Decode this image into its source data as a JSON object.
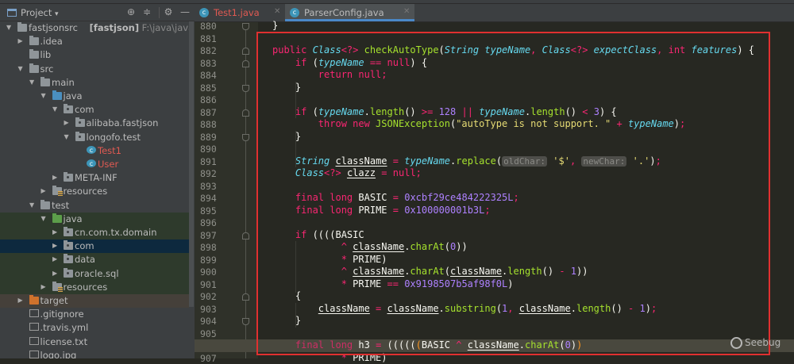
{
  "panel": {
    "title": "Project",
    "dropdown_icon": "▾",
    "icons": [
      "locate-icon",
      "collapse-all-icon",
      "gear-icon",
      "minimize-icon"
    ]
  },
  "tree": [
    {
      "label": "fastjsonsrc",
      "bold": "[fastjson]",
      "path": "F:\\java\\javaproject\\fast",
      "depth": 0,
      "arrow": "open",
      "icon": "module"
    },
    {
      "label": ".idea",
      "depth": 1,
      "arrow": "closed",
      "icon": "folder"
    },
    {
      "label": "lib",
      "depth": 1,
      "arrow": "none",
      "icon": "folder"
    },
    {
      "label": "src",
      "depth": 1,
      "arrow": "open",
      "icon": "folder"
    },
    {
      "label": "main",
      "depth": 2,
      "arrow": "open",
      "icon": "folder"
    },
    {
      "label": "java",
      "depth": 3,
      "arrow": "open",
      "icon": "src"
    },
    {
      "label": "com",
      "depth": 4,
      "arrow": "open",
      "icon": "package"
    },
    {
      "label": "alibaba.fastjson",
      "depth": 5,
      "arrow": "closed",
      "icon": "package"
    },
    {
      "label": "longofo.test",
      "depth": 5,
      "arrow": "open",
      "icon": "package"
    },
    {
      "label": "Test1",
      "depth": 6,
      "arrow": "none",
      "icon": "class",
      "color": "#e05a52"
    },
    {
      "label": "User",
      "depth": 6,
      "arrow": "none",
      "icon": "class",
      "color": "#e05a52"
    },
    {
      "label": "META-INF",
      "depth": 4,
      "arrow": "closed",
      "icon": "package"
    },
    {
      "label": "resources",
      "depth": 3,
      "arrow": "closed",
      "icon": "resources"
    },
    {
      "label": "test",
      "depth": 2,
      "arrow": "open",
      "icon": "folder"
    },
    {
      "label": "java",
      "depth": 3,
      "arrow": "open",
      "icon": "test",
      "bg": "#2e3a2c"
    },
    {
      "label": "cn.com.tx.domain",
      "depth": 4,
      "arrow": "closed",
      "icon": "package",
      "bg": "#2e3a2c"
    },
    {
      "label": "com",
      "depth": 4,
      "arrow": "closed",
      "icon": "package",
      "bg": "#0d293e"
    },
    {
      "label": "data",
      "depth": 4,
      "arrow": "closed",
      "icon": "package",
      "bg": "#2e3a2c"
    },
    {
      "label": "oracle.sql",
      "depth": 4,
      "arrow": "closed",
      "icon": "package",
      "bg": "#2e3a2c"
    },
    {
      "label": "resources",
      "depth": 3,
      "arrow": "closed",
      "icon": "resources",
      "bg": "#2e3a2c"
    },
    {
      "label": "target",
      "depth": 1,
      "arrow": "closed",
      "icon": "target",
      "bg": "#45403a"
    },
    {
      "label": ".gitignore",
      "depth": 1,
      "arrow": "none",
      "icon": "file"
    },
    {
      "label": ".travis.yml",
      "depth": 1,
      "arrow": "none",
      "icon": "file"
    },
    {
      "label": "license.txt",
      "depth": 1,
      "arrow": "none",
      "icon": "file"
    },
    {
      "label": "logo.jpg",
      "depth": 1,
      "arrow": "none",
      "icon": "file"
    }
  ],
  "tabs": [
    {
      "label": "Test1.java",
      "active": false,
      "color": "#e05a52"
    },
    {
      "label": "ParserConfig.java",
      "active": true,
      "color": "#bbbbbb"
    }
  ],
  "editor": {
    "current_line": 906,
    "lines": [
      {
        "no": 880,
        "fold": "end",
        "tokens": [
          [
            "x",
            "}"
          ]
        ]
      },
      {
        "no": 881,
        "tokens": []
      },
      {
        "no": 882,
        "fold": "start",
        "tokens": [
          [
            "k",
            "public "
          ],
          [
            "t",
            "Class"
          ],
          [
            "k",
            "<?>"
          ],
          [
            "x",
            " "
          ],
          [
            "f",
            "checkAutoType"
          ],
          [
            "x",
            "("
          ],
          [
            "t",
            "String"
          ],
          [
            "x",
            " "
          ],
          [
            "p",
            "typeName"
          ],
          [
            "o",
            ", "
          ],
          [
            "t",
            "Class"
          ],
          [
            "k",
            "<?>"
          ],
          [
            "x",
            " "
          ],
          [
            "p",
            "expectClass"
          ],
          [
            "o",
            ", "
          ],
          [
            "k",
            "int "
          ],
          [
            "p",
            "features"
          ],
          [
            "x",
            ") {"
          ]
        ]
      },
      {
        "no": 883,
        "fold": "start",
        "tokens": [
          [
            "x",
            "    "
          ],
          [
            "k",
            "if"
          ],
          [
            "x",
            " ("
          ],
          [
            "p",
            "typeName"
          ],
          [
            "o",
            " == "
          ],
          [
            "k",
            "null"
          ],
          [
            "x",
            ") {"
          ]
        ]
      },
      {
        "no": 884,
        "tokens": [
          [
            "x",
            "        "
          ],
          [
            "k",
            "return null"
          ],
          [
            "k",
            ";"
          ]
        ]
      },
      {
        "no": 885,
        "fold": "end",
        "tokens": [
          [
            "x",
            "    }"
          ]
        ]
      },
      {
        "no": 886,
        "tokens": []
      },
      {
        "no": 887,
        "fold": "start",
        "tokens": [
          [
            "x",
            "    "
          ],
          [
            "k",
            "if"
          ],
          [
            "x",
            " ("
          ],
          [
            "p",
            "typeName"
          ],
          [
            "x",
            "."
          ],
          [
            "f",
            "length"
          ],
          [
            "x",
            "() "
          ],
          [
            "o",
            ">="
          ],
          [
            "x",
            " "
          ],
          [
            "n",
            "128"
          ],
          [
            "x",
            " "
          ],
          [
            "o",
            "||"
          ],
          [
            "x",
            " "
          ],
          [
            "p",
            "typeName"
          ],
          [
            "x",
            "."
          ],
          [
            "f",
            "length"
          ],
          [
            "x",
            "() "
          ],
          [
            "o",
            "<"
          ],
          [
            "x",
            " "
          ],
          [
            "n",
            "3"
          ],
          [
            "x",
            ") {"
          ]
        ]
      },
      {
        "no": 888,
        "tokens": [
          [
            "x",
            "        "
          ],
          [
            "k",
            "throw new "
          ],
          [
            "f",
            "JSONException"
          ],
          [
            "x",
            "("
          ],
          [
            "s",
            "\"autoType is not support. \""
          ],
          [
            "o",
            " + "
          ],
          [
            "p",
            "typeName"
          ],
          [
            "x",
            ")"
          ],
          [
            "k",
            ";"
          ]
        ]
      },
      {
        "no": 889,
        "fold": "end",
        "tokens": [
          [
            "x",
            "    }"
          ]
        ]
      },
      {
        "no": 890,
        "tokens": []
      },
      {
        "no": 891,
        "tokens": [
          [
            "x",
            "    "
          ],
          [
            "t",
            "String"
          ],
          [
            "x",
            " "
          ],
          [
            "v",
            "className"
          ],
          [
            "o",
            " = "
          ],
          [
            "p",
            "typeName"
          ],
          [
            "x",
            "."
          ],
          [
            "f",
            "replace"
          ],
          [
            "x",
            "("
          ],
          [
            "h",
            "oldChar:"
          ],
          [
            "x",
            " "
          ],
          [
            "s",
            "'$'"
          ],
          [
            "o",
            ", "
          ],
          [
            "h",
            "newChar:"
          ],
          [
            "x",
            " "
          ],
          [
            "s",
            "'.'"
          ],
          [
            "x",
            ")"
          ],
          [
            "k",
            ";"
          ]
        ]
      },
      {
        "no": 892,
        "tokens": [
          [
            "x",
            "    "
          ],
          [
            "t",
            "Class"
          ],
          [
            "k",
            "<?>"
          ],
          [
            "x",
            " "
          ],
          [
            "v",
            "clazz"
          ],
          [
            "o",
            " = "
          ],
          [
            "k",
            "null;"
          ]
        ]
      },
      {
        "no": 893,
        "tokens": []
      },
      {
        "no": 894,
        "tokens": [
          [
            "x",
            "    "
          ],
          [
            "k",
            "final long "
          ],
          [
            "x",
            "BASIC "
          ],
          [
            "o",
            "="
          ],
          [
            "x",
            " "
          ],
          [
            "n",
            "0xcbf29ce484222325L"
          ],
          [
            "k",
            ";"
          ]
        ]
      },
      {
        "no": 895,
        "tokens": [
          [
            "x",
            "    "
          ],
          [
            "k",
            "final long "
          ],
          [
            "x",
            "PRIME "
          ],
          [
            "o",
            "="
          ],
          [
            "x",
            " "
          ],
          [
            "n",
            "0x100000001b3L"
          ],
          [
            "k",
            ";"
          ]
        ]
      },
      {
        "no": 896,
        "tokens": []
      },
      {
        "no": 897,
        "fold": "start",
        "tokens": [
          [
            "x",
            "    "
          ],
          [
            "k",
            "if"
          ],
          [
            "x",
            " ((((BASIC"
          ]
        ]
      },
      {
        "no": 898,
        "tokens": [
          [
            "x",
            "            "
          ],
          [
            "o",
            "^ "
          ],
          [
            "v",
            "className"
          ],
          [
            "x",
            "."
          ],
          [
            "f",
            "charAt"
          ],
          [
            "x",
            "("
          ],
          [
            "n",
            "0"
          ],
          [
            "x",
            "))"
          ]
        ]
      },
      {
        "no": 899,
        "tokens": [
          [
            "x",
            "            "
          ],
          [
            "o",
            "* "
          ],
          [
            "x",
            "PRIME)"
          ]
        ]
      },
      {
        "no": 900,
        "tokens": [
          [
            "x",
            "            "
          ],
          [
            "o",
            "^ "
          ],
          [
            "v",
            "className"
          ],
          [
            "x",
            "."
          ],
          [
            "f",
            "charAt"
          ],
          [
            "x",
            "("
          ],
          [
            "v",
            "className"
          ],
          [
            "x",
            "."
          ],
          [
            "f",
            "length"
          ],
          [
            "x",
            "() "
          ],
          [
            "o",
            "-"
          ],
          [
            "x",
            " "
          ],
          [
            "n",
            "1"
          ],
          [
            "x",
            "))"
          ]
        ]
      },
      {
        "no": 901,
        "tokens": [
          [
            "x",
            "            "
          ],
          [
            "o",
            "* "
          ],
          [
            "x",
            "PRIME "
          ],
          [
            "o",
            "=="
          ],
          [
            "x",
            " "
          ],
          [
            "n",
            "0x9198507b5af98f0L"
          ],
          [
            "x",
            ")"
          ]
        ]
      },
      {
        "no": 902,
        "fold": "start",
        "tokens": [
          [
            "x",
            "    {"
          ]
        ]
      },
      {
        "no": 903,
        "tokens": [
          [
            "x",
            "        "
          ],
          [
            "v",
            "className"
          ],
          [
            "o",
            " = "
          ],
          [
            "v",
            "className"
          ],
          [
            "x",
            "."
          ],
          [
            "f",
            "substring"
          ],
          [
            "x",
            "("
          ],
          [
            "n",
            "1"
          ],
          [
            "o",
            ", "
          ],
          [
            "v",
            "className"
          ],
          [
            "x",
            "."
          ],
          [
            "f",
            "length"
          ],
          [
            "x",
            "() "
          ],
          [
            "o",
            "-"
          ],
          [
            "x",
            " "
          ],
          [
            "n",
            "1"
          ],
          [
            "x",
            ")"
          ],
          [
            "k",
            ";"
          ]
        ]
      },
      {
        "no": 904,
        "fold": "end",
        "tokens": [
          [
            "x",
            "    }"
          ]
        ]
      },
      {
        "no": 905,
        "tokens": []
      },
      {
        "no": 906,
        "fold": "start",
        "tokens": [
          [
            "x",
            "    "
          ],
          [
            "k",
            "final long "
          ],
          [
            "x",
            "h3 "
          ],
          [
            "o",
            "="
          ],
          [
            "x",
            " ((((("
          ],
          [
            "m",
            "("
          ],
          [
            "x",
            "BASIC "
          ],
          [
            "o",
            "^"
          ],
          [
            "x",
            " "
          ],
          [
            "v",
            "className"
          ],
          [
            "x",
            "."
          ],
          [
            "f",
            "charAt"
          ],
          [
            "x",
            "("
          ],
          [
            "n",
            "0"
          ],
          [
            "x",
            ")"
          ],
          [
            "m",
            ")"
          ]
        ]
      },
      {
        "no": 907,
        "tokens": [
          [
            "x",
            "            "
          ],
          [
            "o",
            "* "
          ],
          [
            "x",
            "PRIME)"
          ]
        ]
      }
    ]
  },
  "watermark": {
    "text": "Seebug"
  }
}
